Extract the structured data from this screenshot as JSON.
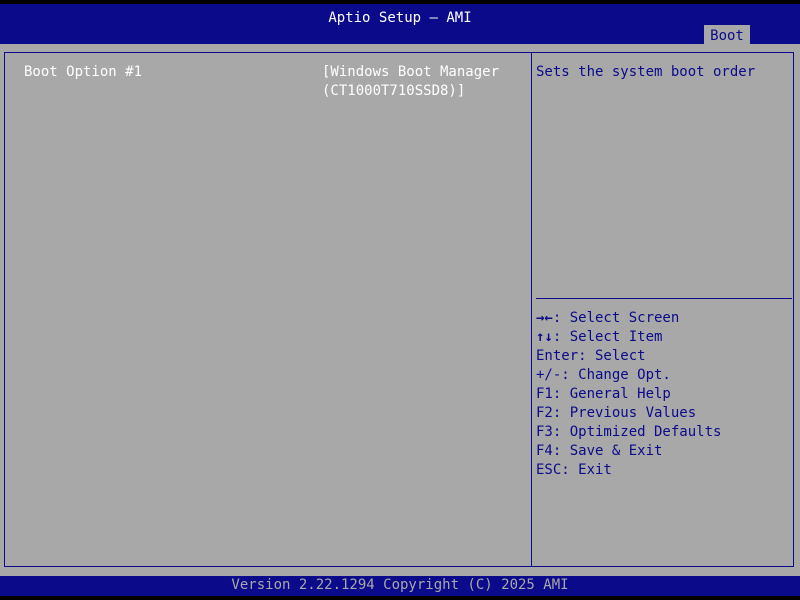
{
  "header": {
    "title": "Aptio Setup – AMI",
    "active_tab": "Boot"
  },
  "options": [
    {
      "label": "Boot Option #1",
      "value_line1": "[Windows Boot Manager",
      "value_line2": "(CT1000T710SSD8)]"
    }
  ],
  "help": {
    "description": "Sets the system boot order"
  },
  "keys": [
    {
      "glyph": "→←",
      "text": ": Select Screen"
    },
    {
      "glyph": "↑↓",
      "text": ": Select Item"
    },
    {
      "glyph": "",
      "text": "Enter: Select"
    },
    {
      "glyph": "",
      "text": "+/-: Change Opt."
    },
    {
      "glyph": "",
      "text": "F1: General Help"
    },
    {
      "glyph": "",
      "text": "F2: Previous Values"
    },
    {
      "glyph": "",
      "text": "F3: Optimized Defaults"
    },
    {
      "glyph": "",
      "text": "F4: Save & Exit"
    },
    {
      "glyph": "",
      "text": "ESC: Exit"
    }
  ],
  "footer": {
    "version": "Version 2.22.1294 Copyright (C) 2025 AMI"
  },
  "colors": {
    "background_blue": "#0a0a8a",
    "panel_gray": "#a8a8a8",
    "text_white": "#ffffff"
  }
}
